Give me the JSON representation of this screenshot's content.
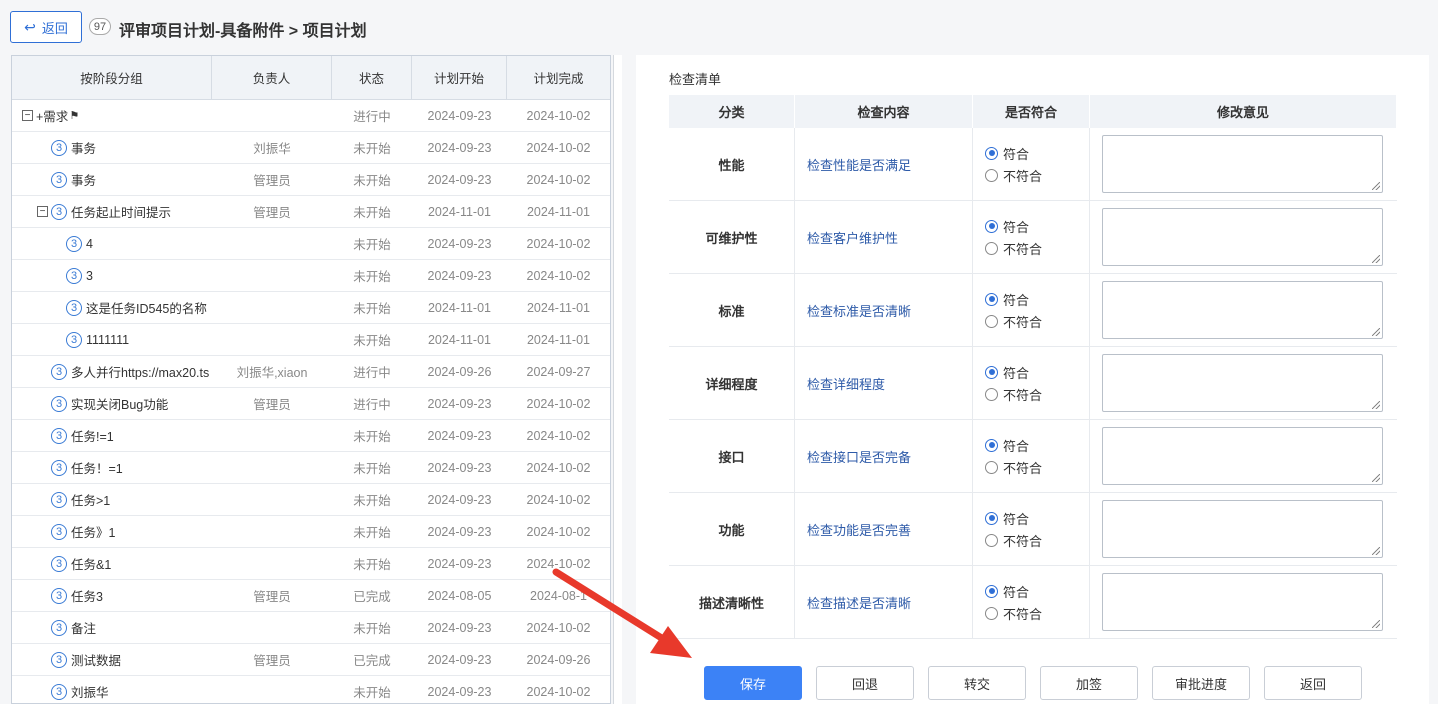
{
  "header": {
    "back_label": "返回",
    "count": "97",
    "title": "评审项目计划-具备附件 > 项目计划"
  },
  "tree_table": {
    "columns": [
      "按阶段分组",
      "负责人",
      "状态",
      "计划开始",
      "计划完成"
    ],
    "rows": [
      {
        "name": "+需求",
        "owner": "",
        "status": "进行中",
        "start": "2024-09-23",
        "end": "2024-10-02",
        "level": 0,
        "type": "group"
      },
      {
        "name": "事务",
        "owner": "刘振华",
        "status": "未开始",
        "start": "2024-09-23",
        "end": "2024-10-02",
        "level": 1,
        "type": "task"
      },
      {
        "name": "事务",
        "owner": "管理员",
        "status": "未开始",
        "start": "2024-09-23",
        "end": "2024-10-02",
        "level": 1,
        "type": "task"
      },
      {
        "name": "任务起止时间提示",
        "owner": "管理员",
        "status": "未开始",
        "start": "2024-11-01",
        "end": "2024-11-01",
        "level": 1,
        "type": "parent"
      },
      {
        "name": "4",
        "owner": "",
        "status": "未开始",
        "start": "2024-09-23",
        "end": "2024-10-02",
        "level": 2,
        "type": "task"
      },
      {
        "name": "3",
        "owner": "",
        "status": "未开始",
        "start": "2024-09-23",
        "end": "2024-10-02",
        "level": 2,
        "type": "task"
      },
      {
        "name": "这是任务ID545的名称",
        "owner": "",
        "status": "未开始",
        "start": "2024-11-01",
        "end": "2024-11-01",
        "level": 2,
        "type": "task"
      },
      {
        "name": "1111111",
        "owner": "",
        "status": "未开始",
        "start": "2024-11-01",
        "end": "2024-11-01",
        "level": 2,
        "type": "task"
      },
      {
        "name": "多人并行https://max20.ts",
        "owner": "刘振华,xiaon",
        "status": "进行中",
        "start": "2024-09-26",
        "end": "2024-09-27",
        "level": 1,
        "type": "task"
      },
      {
        "name": "实现关闭Bug功能",
        "owner": "管理员",
        "status": "进行中",
        "start": "2024-09-23",
        "end": "2024-10-02",
        "level": 1,
        "type": "task"
      },
      {
        "name": "任务!=1",
        "owner": "",
        "status": "未开始",
        "start": "2024-09-23",
        "end": "2024-10-02",
        "level": 1,
        "type": "task"
      },
      {
        "name": "任务！=1",
        "owner": "",
        "status": "未开始",
        "start": "2024-09-23",
        "end": "2024-10-02",
        "level": 1,
        "type": "task"
      },
      {
        "name": "任务>1",
        "owner": "",
        "status": "未开始",
        "start": "2024-09-23",
        "end": "2024-10-02",
        "level": 1,
        "type": "task"
      },
      {
        "name": "任务》1",
        "owner": "",
        "status": "未开始",
        "start": "2024-09-23",
        "end": "2024-10-02",
        "level": 1,
        "type": "task"
      },
      {
        "name": "任务&1",
        "owner": "",
        "status": "未开始",
        "start": "2024-09-23",
        "end": "2024-10-02",
        "level": 1,
        "type": "task"
      },
      {
        "name": "任务3",
        "owner": "管理员",
        "status": "已完成",
        "start": "2024-08-05",
        "end": "2024-08-1",
        "level": 1,
        "type": "task"
      },
      {
        "name": "备注",
        "owner": "",
        "status": "未开始",
        "start": "2024-09-23",
        "end": "2024-10-02",
        "level": 1,
        "type": "task"
      },
      {
        "name": "测试数据",
        "owner": "管理员",
        "status": "已完成",
        "start": "2024-09-23",
        "end": "2024-09-26",
        "level": 1,
        "type": "task"
      },
      {
        "name": "刘振华",
        "owner": "",
        "status": "未开始",
        "start": "2024-09-23",
        "end": "2024-10-02",
        "level": 1,
        "type": "task"
      }
    ],
    "task_icon_glyph": "3",
    "group_flag_glyph": "⚑"
  },
  "checklist": {
    "title": "检查清单",
    "columns": [
      "分类",
      "检查内容",
      "是否符合",
      "修改意见"
    ],
    "option_yes": "符合",
    "option_no": "不符合",
    "rows": [
      {
        "category": "性能",
        "content": "检查性能是否满足",
        "compliant": true,
        "comment": ""
      },
      {
        "category": "可维护性",
        "content": "检查客户维护性",
        "compliant": true,
        "comment": ""
      },
      {
        "category": "标准",
        "content": "检查标准是否清晰",
        "compliant": true,
        "comment": ""
      },
      {
        "category": "详细程度",
        "content": "检查详细程度",
        "compliant": true,
        "comment": ""
      },
      {
        "category": "接口",
        "content": "检查接口是否完备",
        "compliant": true,
        "comment": ""
      },
      {
        "category": "功能",
        "content": "检查功能是否完善",
        "compliant": true,
        "comment": ""
      },
      {
        "category": "描述清晰性",
        "content": "检查描述是否清晰",
        "compliant": true,
        "comment": ""
      }
    ]
  },
  "actions": {
    "save": "保存",
    "rollback": "回退",
    "transfer": "转交",
    "add_sign": "加签",
    "approval_progress": "审批进度",
    "back": "返回"
  },
  "colors": {
    "primary": "#3c82f6",
    "link": "#2d5aa8",
    "annotation_arrow": "#e8392b"
  }
}
